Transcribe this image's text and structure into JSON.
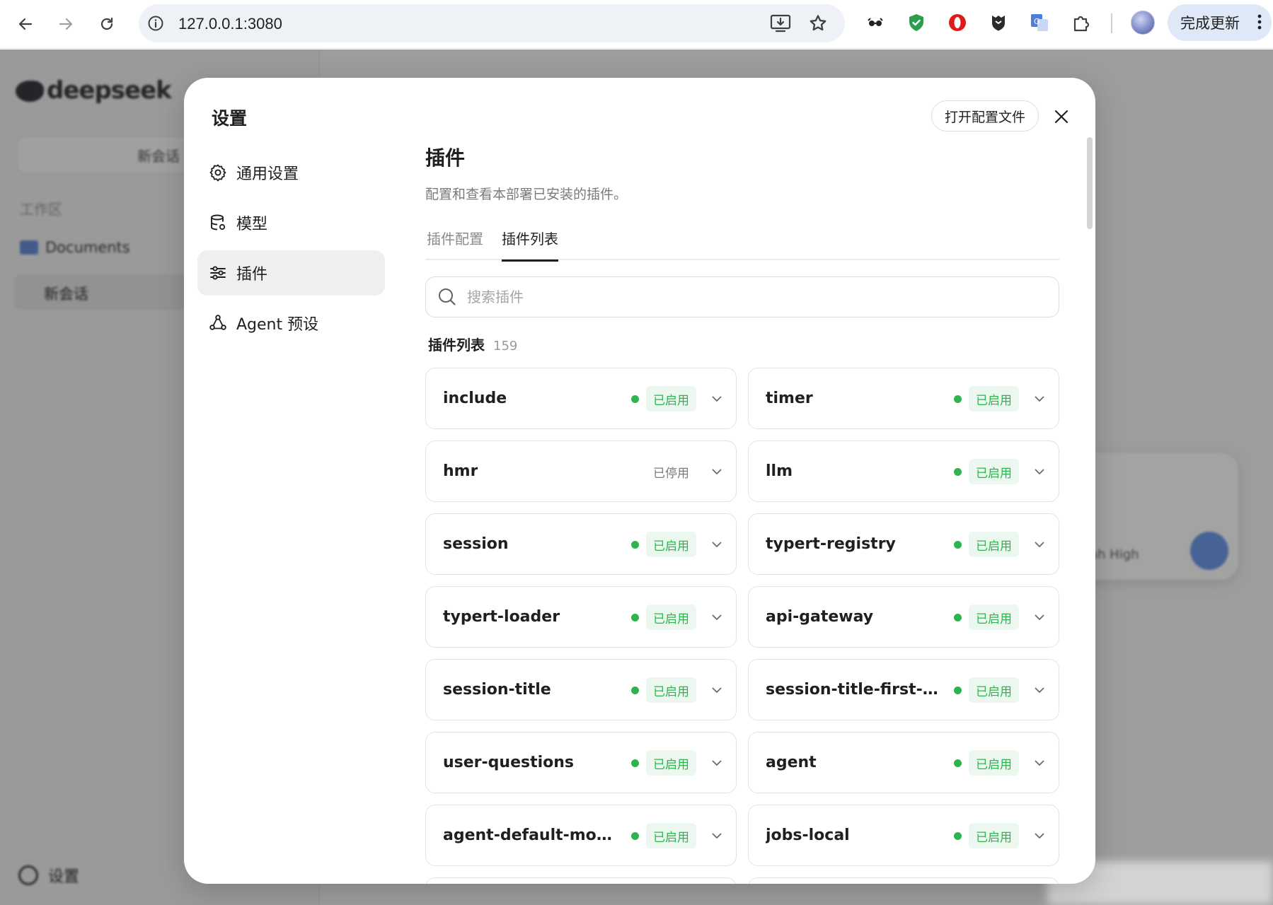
{
  "browser": {
    "url": "127.0.0.1:3080",
    "update_button_label": "完成更新",
    "extensions": [
      "glasses-icon",
      "shield-check-icon",
      "opera-icon",
      "vpn-shield-icon",
      "translate-icon",
      "puzzle-icon"
    ]
  },
  "background_app": {
    "logo_text": "deepseek",
    "new_chat_label": "新会话",
    "workspace_section": "工作区",
    "folder_name": "Documents",
    "chat_item": "新会话",
    "settings_label": "设置",
    "model_hint": "ah High"
  },
  "settings": {
    "title": "设置",
    "open_config_label": "打开配置文件",
    "nav": [
      {
        "label": "通用设置",
        "icon": "gear-icon",
        "active": false
      },
      {
        "label": "模型",
        "icon": "database-icon",
        "active": false
      },
      {
        "label": "插件",
        "icon": "sliders-icon",
        "active": true
      },
      {
        "label": "Agent 预设",
        "icon": "agent-icon",
        "active": false
      }
    ],
    "page": {
      "title": "插件",
      "description": "配置和查看本部署已安装的插件。",
      "tabs": [
        {
          "label": "插件配置",
          "active": false
        },
        {
          "label": "插件列表",
          "active": true
        }
      ],
      "search_placeholder": "搜索插件",
      "list_title": "插件列表",
      "list_count": "159"
    },
    "plugins": [
      {
        "name": "include",
        "status": "已启用",
        "enabled": true
      },
      {
        "name": "timer",
        "status": "已启用",
        "enabled": true
      },
      {
        "name": "hmr",
        "status": "已停用",
        "enabled": false
      },
      {
        "name": "llm",
        "status": "已启用",
        "enabled": true
      },
      {
        "name": "session",
        "status": "已启用",
        "enabled": true
      },
      {
        "name": "typert-registry",
        "status": "已启用",
        "enabled": true
      },
      {
        "name": "typert-loader",
        "status": "已启用",
        "enabled": true
      },
      {
        "name": "api-gateway",
        "status": "已启用",
        "enabled": true
      },
      {
        "name": "session-title",
        "status": "已启用",
        "enabled": true
      },
      {
        "name": "session-title-first-pr...",
        "status": "已启用",
        "enabled": true
      },
      {
        "name": "user-questions",
        "status": "已启用",
        "enabled": true
      },
      {
        "name": "agent",
        "status": "已启用",
        "enabled": true
      },
      {
        "name": "agent-default-model",
        "status": "已启用",
        "enabled": true
      },
      {
        "name": "jobs-local",
        "status": "已启用",
        "enabled": true
      }
    ],
    "colors": {
      "enabled_green": "#2fb34f",
      "enabled_badge_bg": "#ecf8ef",
      "disabled_text": "#7a7a7a"
    }
  }
}
